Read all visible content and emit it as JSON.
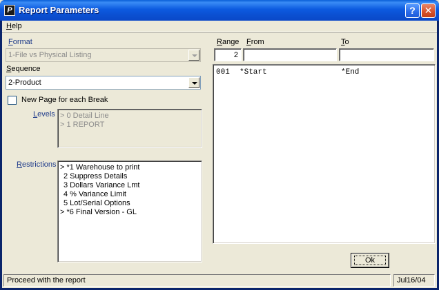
{
  "window": {
    "title": "Report Parameters",
    "app_icon_letter": "P",
    "help_button": "?",
    "close_button": "✕"
  },
  "menu": {
    "help": "Help"
  },
  "format": {
    "label": "Format",
    "value": "1-File vs Physical Listing"
  },
  "sequence": {
    "label": "Sequence",
    "value": "2-Product"
  },
  "new_page": {
    "label": "New Page for each Break",
    "checked": false
  },
  "levels": {
    "label": "Levels",
    "items": [
      "> 0 Detail Line",
      "> 1 REPORT"
    ]
  },
  "restrictions": {
    "label": "Restrictions",
    "items": [
      "> *1 Warehouse to print",
      "2 Suppress Details",
      "3 Dollars Variance Lmt",
      "4 % Variance Limit",
      "5 Lot/Serial Options",
      "> *6 Final Version - GL"
    ]
  },
  "range": {
    "range_label": "Range",
    "from_label": "From",
    "to_label": "To",
    "range_value": "2",
    "from_value": "",
    "to_value": "",
    "rows": [
      {
        "num": "001",
        "from": "*Start",
        "to": "*End"
      }
    ]
  },
  "ok_button": "Ok",
  "status": {
    "message": "Proceed with the report",
    "date": "Jul16/04"
  }
}
